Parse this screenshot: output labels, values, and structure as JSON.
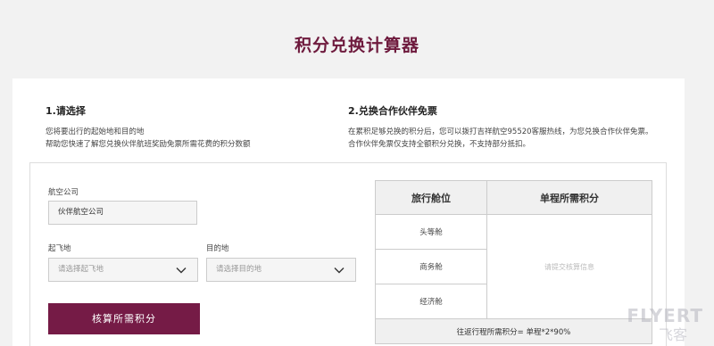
{
  "page_title": "积分兑换计算器",
  "step1": {
    "title": "1.请选择",
    "line1": "您将要出行的起始地和目的地",
    "line2": "帮助您快速了解您兑换伙伴航班奖励免票所需花费的积分数额"
  },
  "step2": {
    "title": "2.兑换合作伙伴免票",
    "line1": "在累积足够兑换的积分后，您可以拨打吉祥航空95520客服热线，为您兑换合作伙伴免票。",
    "line2": "合作伙伴免票仅支持全额积分兑换，不支持部分抵扣。"
  },
  "form": {
    "airline_label": "航空公司",
    "airline_value": "伙伴航空公司",
    "origin_label": "起飞地",
    "origin_placeholder": "请选择起飞地",
    "destination_label": "目的地",
    "destination_placeholder": "请选择目的地",
    "submit_label": "核算所需积分"
  },
  "table": {
    "col_cabin": "旅行舱位",
    "col_points": "单程所需积分",
    "rows": [
      "头等舱",
      "商务舱",
      "经济舱"
    ],
    "result_placeholder": "请提交核算信息",
    "footer": "往返行程所需积分= 单程*2*90%"
  },
  "watermark": {
    "text": "FLYERT",
    "text2": "飞客"
  },
  "colors": {
    "accent": "#751b46",
    "title": "#6e1a3d"
  }
}
